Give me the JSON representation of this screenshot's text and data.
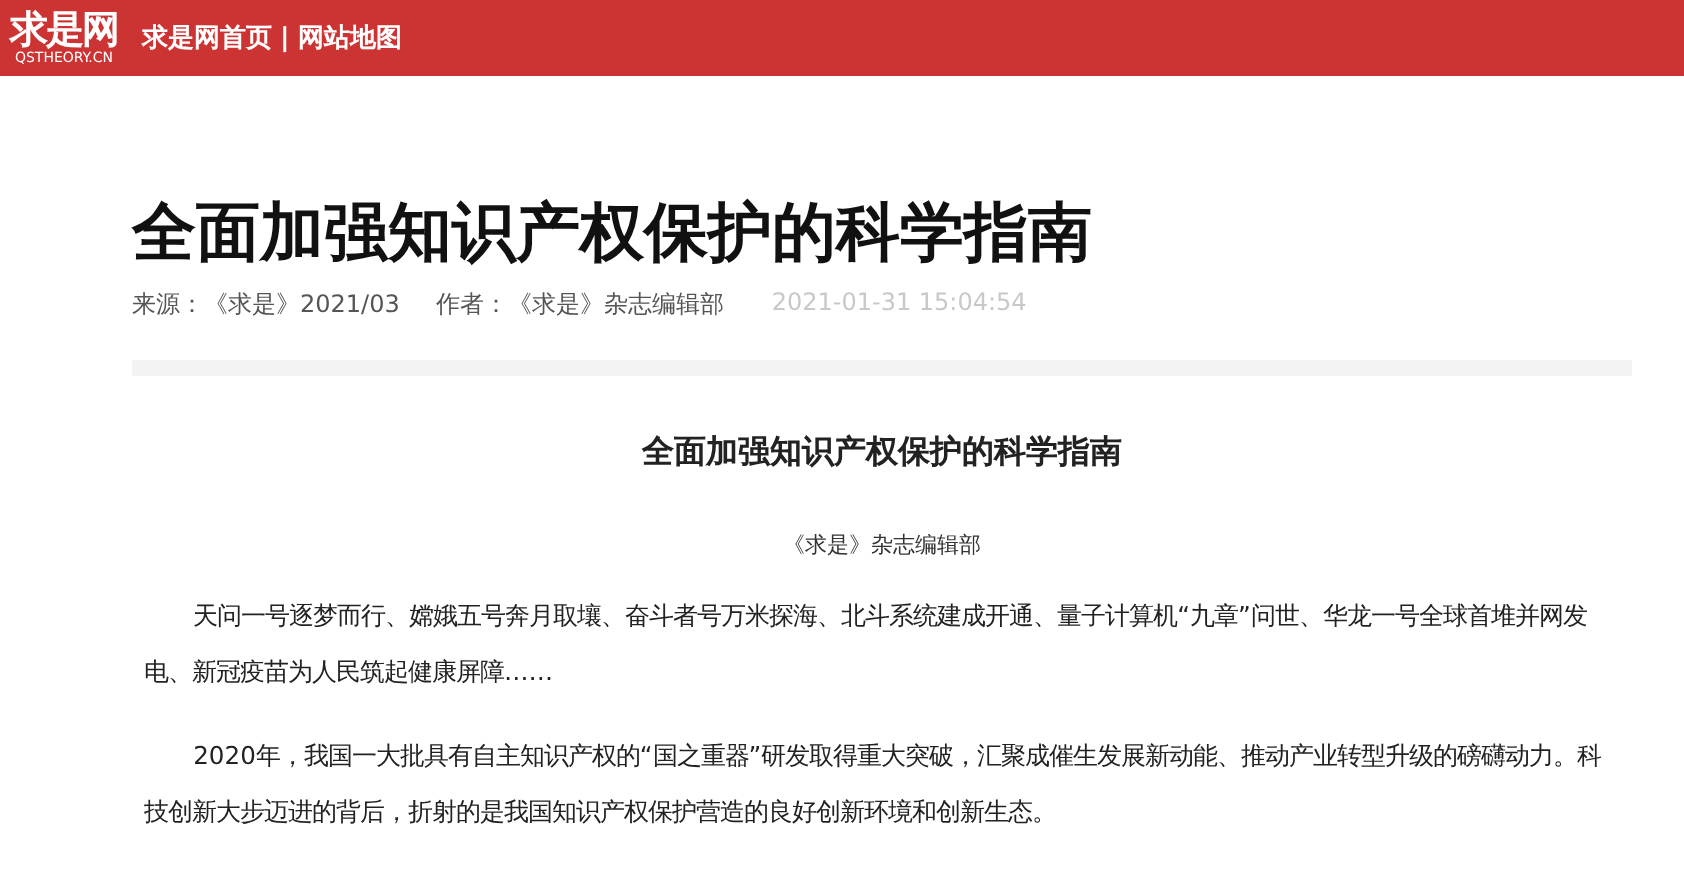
{
  "header": {
    "logo": {
      "name": "求是网",
      "domain": "QSTHEORY.CN"
    },
    "nav": [
      {
        "label": "求是网首页"
      },
      {
        "label": "网站地图"
      }
    ],
    "separator": "|"
  },
  "article": {
    "title": "全面加强知识产权保护的科学指南",
    "meta": [
      {
        "kind": "source",
        "text": "来源：《求是》2021/03"
      },
      {
        "kind": "author",
        "text": "作者：《求是》杂志编辑部"
      },
      {
        "kind": "date",
        "text": "2021-01-31 15:04:54"
      }
    ],
    "subtitle": "全面加强知识产权保护的科学指南",
    "byline": "《求是》杂志编辑部",
    "paragraphs": [
      "天问一号逐梦而行、嫦娥五号奔月取壤、奋斗者号万米探海、北斗系统建成开通、量子计算机“九章”问世、华龙一号全球首堆并网发电、新冠疫苗为人民筑起健康屏障……",
      "2020年，我国一大批具有自主知识产权的“国之重器”研发取得重大突破，汇聚成催生发展新动能、推动产业转型升级的磅礴动力。科技创新大步迈进的背后，折射的是我国知识产权保护营造的良好创新环境和创新生态。"
    ]
  }
}
